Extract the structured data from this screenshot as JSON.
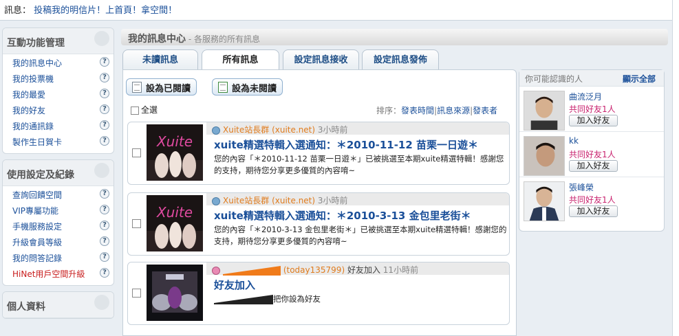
{
  "topbar": {
    "label": "訊息：",
    "message": "投稿我的明信片！上首頁！拿空間！"
  },
  "sidebar": {
    "sections": [
      {
        "title": "互動功能管理",
        "items": [
          "我的訊息中心",
          "我的投票機",
          "我的最愛",
          "我的好友",
          "我的通訊錄",
          "製作生日賀卡"
        ]
      },
      {
        "title": "使用設定及紀錄",
        "items": [
          "查詢回饋空間",
          "VIP專屬功能",
          "手機服務設定",
          "升級會員等級",
          "我的問答記錄",
          "HiNet用戶空間升級"
        ]
      },
      {
        "title": "個人資料",
        "items": []
      }
    ],
    "help_glyph": "?"
  },
  "main": {
    "title": "我的訊息中心",
    "subtitle": " - 各服務的所有訊息",
    "tabs": [
      "未讀訊息",
      "所有訊息",
      "設定訊息接收",
      "設定訊息發佈"
    ],
    "active_tab": "所有訊息",
    "mark_read": "設為已閱讀",
    "mark_unread": "設為未閱讀",
    "select_all": "全選",
    "sort_label": "排序：",
    "sort_options": [
      "發表時間",
      "訊息來源",
      "發表者"
    ],
    "sort_sep": "|"
  },
  "messages": [
    {
      "source": "Xuite站長群 (xuite.net)",
      "time": "3小時前",
      "title": "xuite精選特輯入選通知：＊2010-11-12 苗栗一日遊＊",
      "body": "您的內容「＊2010-11-12 苗栗一日遊＊」已被挑選至本期xuite精選特輯！感謝您的支持，期待您分享更多優質的內容唷~",
      "icon": "xuite-icon"
    },
    {
      "source": "Xuite站長群 (xuite.net)",
      "time": "3小時前",
      "title": "xuite精選特輯入選通知：＊2010-3-13 金包里老街＊",
      "body": "您的內容「＊2010-3-13 金包里老街＊」已被挑選至本期xuite精選特輯！感謝您的支持，期待您分享更多優質的內容唷~",
      "icon": "xuite-icon"
    },
    {
      "source": "(today135799)",
      "action": "好友加入",
      "time": "11小時前",
      "title": "好友加入",
      "body": "把你設為好友",
      "icon": "user-icon"
    }
  ],
  "suggest": {
    "title": "你可能認識的人",
    "show_all": "顯示全部",
    "add_label": "加入好友",
    "people": [
      {
        "name": "曲流泛月",
        "mutual": "共同好友1人"
      },
      {
        "name": "kk",
        "mutual": "共同好友1人"
      },
      {
        "name": "張峰榮",
        "mutual": "共同好友1人"
      }
    ]
  },
  "colors": {
    "link": "#1a4f99",
    "source": "#e07c1e",
    "mutual": "#c8226e",
    "alert": "#c81c1c"
  }
}
